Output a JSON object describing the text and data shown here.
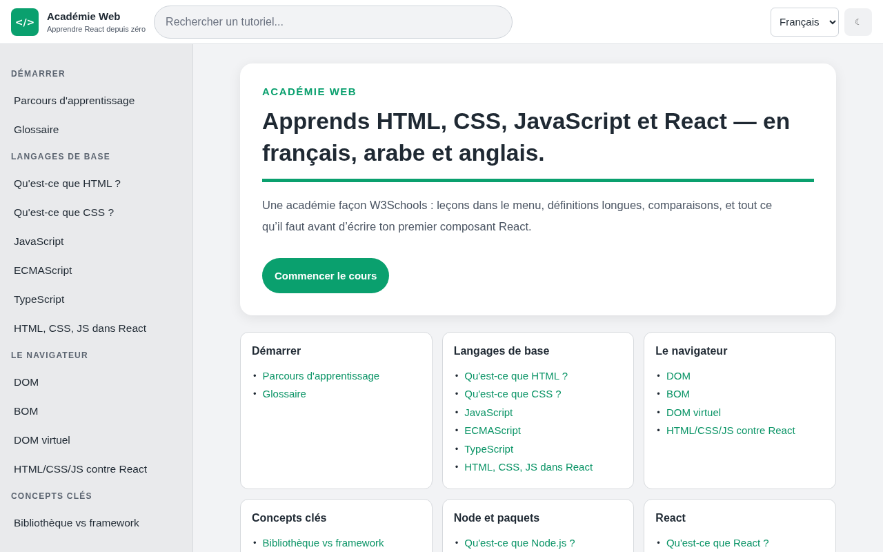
{
  "header": {
    "logo": "</>",
    "title": "Académie Web",
    "subtitle": "Apprendre React depuis zéro",
    "search": {
      "placeholder": "Rechercher un tutoriel..."
    },
    "language": "Français",
    "theme_button": "☾"
  },
  "sidebar": {
    "sections": [
      {
        "title": "DÉMARRER",
        "items": [
          "Parcours d'apprentissage",
          "Glossaire"
        ]
      },
      {
        "title": "LANGAGES DE BASE",
        "items": [
          "Qu'est-ce que HTML ?",
          "Qu'est-ce que CSS ?",
          "JavaScript",
          "ECMAScript",
          "TypeScript",
          "HTML, CSS, JS dans React"
        ]
      },
      {
        "title": "LE NAVIGATEUR",
        "items": [
          "DOM",
          "BOM",
          "DOM virtuel",
          "HTML/CSS/JS contre React"
        ]
      },
      {
        "title": "CONCEPTS CLÉS",
        "items": [
          "Bibliothèque vs framework"
        ]
      }
    ]
  },
  "hero": {
    "eyebrow": "ACADÉMIE WEB",
    "title": "Apprends HTML, CSS, JavaScript et React — en français, arabe et anglais.",
    "text": "Une académie façon W3Schools : leçons dans le menu, définitions longues, comparaisons, et tout ce qu’il faut avant d’écrire ton premier composant React.",
    "button": "Commencer le cours"
  },
  "list_marker": "•",
  "topic_cards": [
    {
      "title": "Démarrer",
      "links": [
        "Parcours d'apprentissage",
        "Glossaire"
      ]
    },
    {
      "title": "Langages de base",
      "links": [
        "Qu'est-ce que HTML ?",
        "Qu'est-ce que CSS ?",
        "JavaScript",
        "ECMAScript",
        "TypeScript",
        "HTML, CSS, JS dans React"
      ]
    },
    {
      "title": "Le navigateur",
      "links": [
        "DOM",
        "BOM",
        "DOM virtuel",
        "HTML/CSS/JS contre React"
      ]
    },
    {
      "title": "Concepts clés",
      "links": [
        "Bibliothèque vs framework"
      ]
    },
    {
      "title": "Node et paquets",
      "links": [
        "Qu'est-ce que Node.js ?"
      ]
    },
    {
      "title": "React",
      "links": [
        "Qu'est-ce que React ?"
      ]
    }
  ]
}
